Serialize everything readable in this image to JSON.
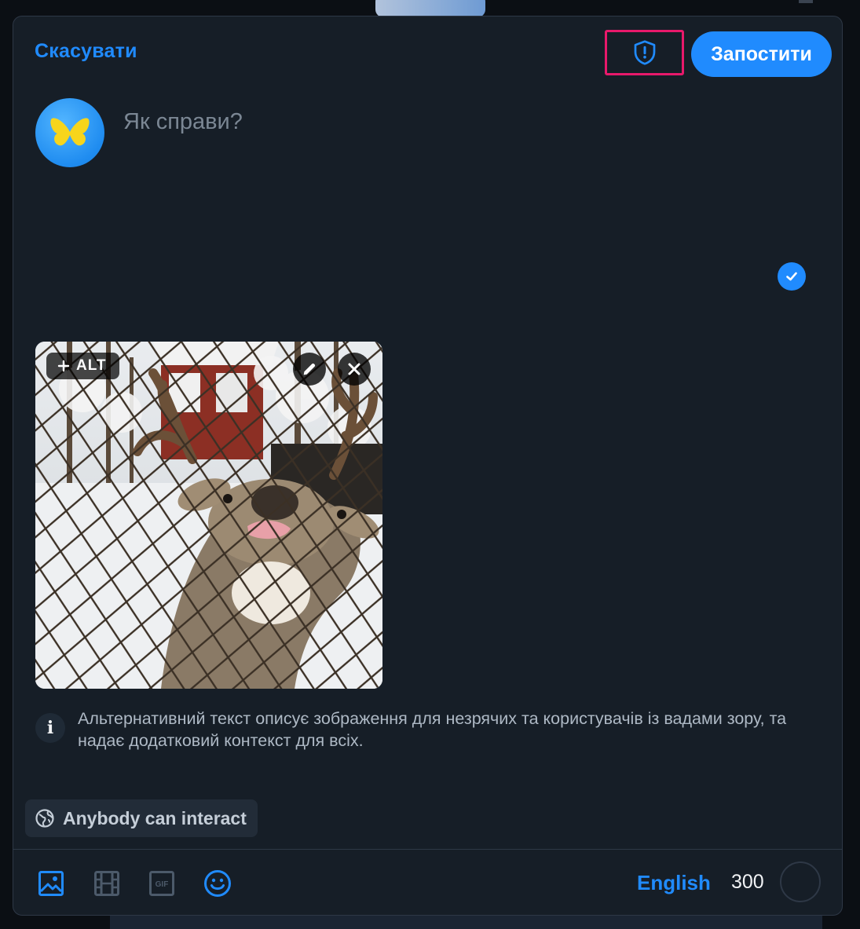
{
  "header": {
    "cancel_label": "Скасувати",
    "post_label": "Запостити"
  },
  "composer": {
    "placeholder": "Як справи?"
  },
  "image": {
    "alt_label": "ALT"
  },
  "info": {
    "text": "Альтернативний текст описує зображення для незрячих та користувачів із вадами зору, та надає додатковий контекст для всіх."
  },
  "interaction": {
    "label": "Anybody can interact"
  },
  "footer": {
    "language": "English",
    "char_count": "300"
  },
  "icons": {
    "labels_shield": "shield-exclamation-icon",
    "image": "image-icon",
    "video": "video-icon",
    "gif": "gif-icon",
    "emoji": "emoji-icon",
    "globe": "globe-icon",
    "check": "check-icon",
    "edit": "pencil-icon",
    "remove": "close-icon",
    "info": "info-icon"
  },
  "colors": {
    "accent": "#208bfe",
    "highlight": "#e8196b",
    "background": "#161e27"
  }
}
